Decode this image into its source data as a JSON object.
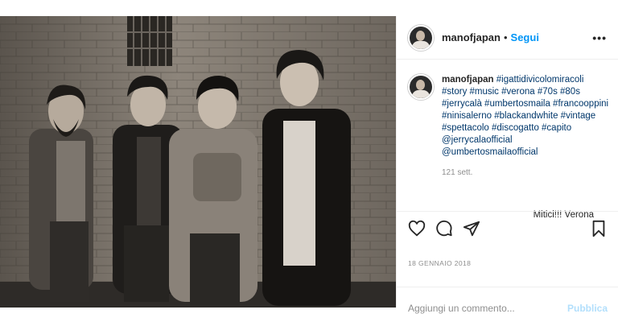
{
  "post": {
    "username": "manofjapan",
    "follow_label": "Segui",
    "separator": "•",
    "more_label": "•••",
    "photo_alt": ""
  },
  "caption": {
    "username": "manofjapan",
    "text": "#igattidivicolomiracoli #story #music #verona #70s #80s #jerrycalà #umbertosmaila #francooppini #ninisalerno #blackandwhite #vintage #spettacolo #discogatto #capito @jerrycalaofficial @umbertosmailaofficial",
    "time": "121 sett."
  },
  "comment": {
    "text": "Mitici!!! Verona"
  },
  "actions": {
    "icons": [
      "heart-icon",
      "comment-icon",
      "share-icon",
      "bookmark-icon"
    ]
  },
  "date": "18 GENNAIO 2018",
  "add_comment": {
    "placeholder": "Aggiungi un commento...",
    "publish_label": "Pubblica"
  },
  "colors": {
    "link": "#00376b",
    "follow": "#0095f6",
    "publish_disabled": "#b2dffc",
    "muted": "#8e8e8e"
  }
}
